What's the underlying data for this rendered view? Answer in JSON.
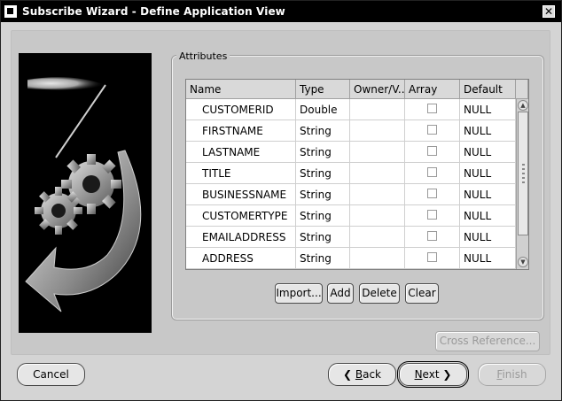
{
  "window": {
    "title": "Subscribe Wizard  - Define Application View",
    "close_glyph": "✕"
  },
  "attributes": {
    "group_label": "Attributes",
    "columns": [
      "Name",
      "Type",
      "Owner/V...",
      "Array",
      "Default"
    ],
    "rows": [
      {
        "name": "CUSTOMERID",
        "type": "Double",
        "owner": "",
        "array": false,
        "default": "NULL"
      },
      {
        "name": "FIRSTNAME",
        "type": "String",
        "owner": "",
        "array": false,
        "default": "NULL"
      },
      {
        "name": "LASTNAME",
        "type": "String",
        "owner": "",
        "array": false,
        "default": "NULL"
      },
      {
        "name": "TITLE",
        "type": "String",
        "owner": "",
        "array": false,
        "default": "NULL"
      },
      {
        "name": "BUSINESSNAME",
        "type": "String",
        "owner": "",
        "array": false,
        "default": "NULL"
      },
      {
        "name": "CUSTOMERTYPE",
        "type": "String",
        "owner": "",
        "array": false,
        "default": "NULL"
      },
      {
        "name": "EMAILADDRESS",
        "type": "String",
        "owner": "",
        "array": false,
        "default": "NULL"
      },
      {
        "name": "ADDRESS",
        "type": "String",
        "owner": "",
        "array": false,
        "default": "NULL"
      }
    ],
    "buttons": {
      "import": "Import...",
      "add": "Add",
      "delete": "Delete",
      "clear": "Clear"
    }
  },
  "cross_reference": "Cross Reference...",
  "footer": {
    "cancel": "Cancel",
    "back_arrow": "❮",
    "back_mnemonic": "B",
    "back_rest": "ack",
    "next_mnemonic": "N",
    "next_rest": "ext",
    "next_arrow": "❯",
    "finish_mnemonic": "F",
    "finish_rest": "inish"
  },
  "icons": {
    "app": "app-icon",
    "close": "close-icon",
    "illustration": "wizard-gears-illustration",
    "scroll_up": "scroll-up-icon",
    "scroll_down": "scroll-down-icon"
  },
  "colors": {
    "titlebar": "#000000",
    "dialog_bg": "#d4d4d4",
    "panel_bg": "#c8c8c8"
  }
}
